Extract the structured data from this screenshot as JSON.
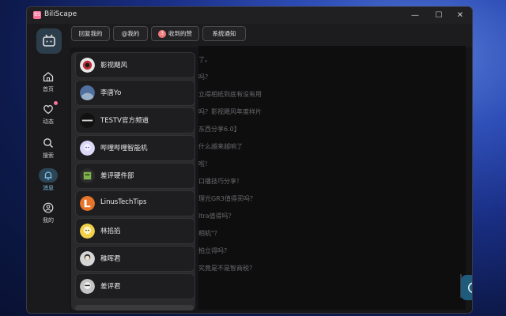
{
  "window": {
    "title": "BiliScape",
    "logo_text": "BS"
  },
  "titlebar_buttons": {
    "minimize": "—",
    "maximize": "☐",
    "close": "✕"
  },
  "sidebar": {
    "items": [
      {
        "label": "首页",
        "icon": "home-icon"
      },
      {
        "label": "动态",
        "icon": "heart-icon"
      },
      {
        "label": "搜索",
        "icon": "search-icon"
      },
      {
        "label": "消息",
        "icon": "bell-icon"
      },
      {
        "label": "我的",
        "icon": "user-icon"
      }
    ],
    "active": "消息"
  },
  "tabs": [
    {
      "label": "回复我的"
    },
    {
      "label": "@我的"
    },
    {
      "label": "收到的赞",
      "badge": "3"
    },
    {
      "label": "系统通知"
    }
  ],
  "up_list": [
    {
      "name": "影视飓风",
      "avatar_color": "#c0303a"
    },
    {
      "name": "李唐Yo",
      "avatar_color": "#7a8aa6"
    },
    {
      "name": "TESTV官方频道",
      "avatar_color": "#2a2a2a"
    },
    {
      "name": "哔哩哔哩智能机",
      "avatar_color": "#c9c4f2"
    },
    {
      "name": "差评硬件部",
      "avatar_color": "#4f7d3a"
    },
    {
      "name": "LinusTechTips",
      "avatar_color": "#e8742a"
    },
    {
      "name": "林掐掐",
      "avatar_color": "#e8c03a"
    },
    {
      "name": "稚晖君",
      "avatar_color": "#d0d0d0"
    },
    {
      "name": "差评君",
      "avatar_color": "#bcbcbc"
    }
  ],
  "content_lines": [
    "了。",
    "吗？",
    "立得相纸到底有没有用",
    "吗？影视飓风年度样片",
    "东西分享6.0】",
    "什么越来越响了",
    "啦！",
    "口播技巧分享！",
    "理光GR3值得买吗？",
    "ltra值得吗？",
    "相机\"？",
    "拍立得吗？",
    "究竟是不是智商税？"
  ],
  "colors": {
    "accent": "#fb7299",
    "active_bg": "#2c4657",
    "refresh_bg": "#1f5b7a"
  }
}
